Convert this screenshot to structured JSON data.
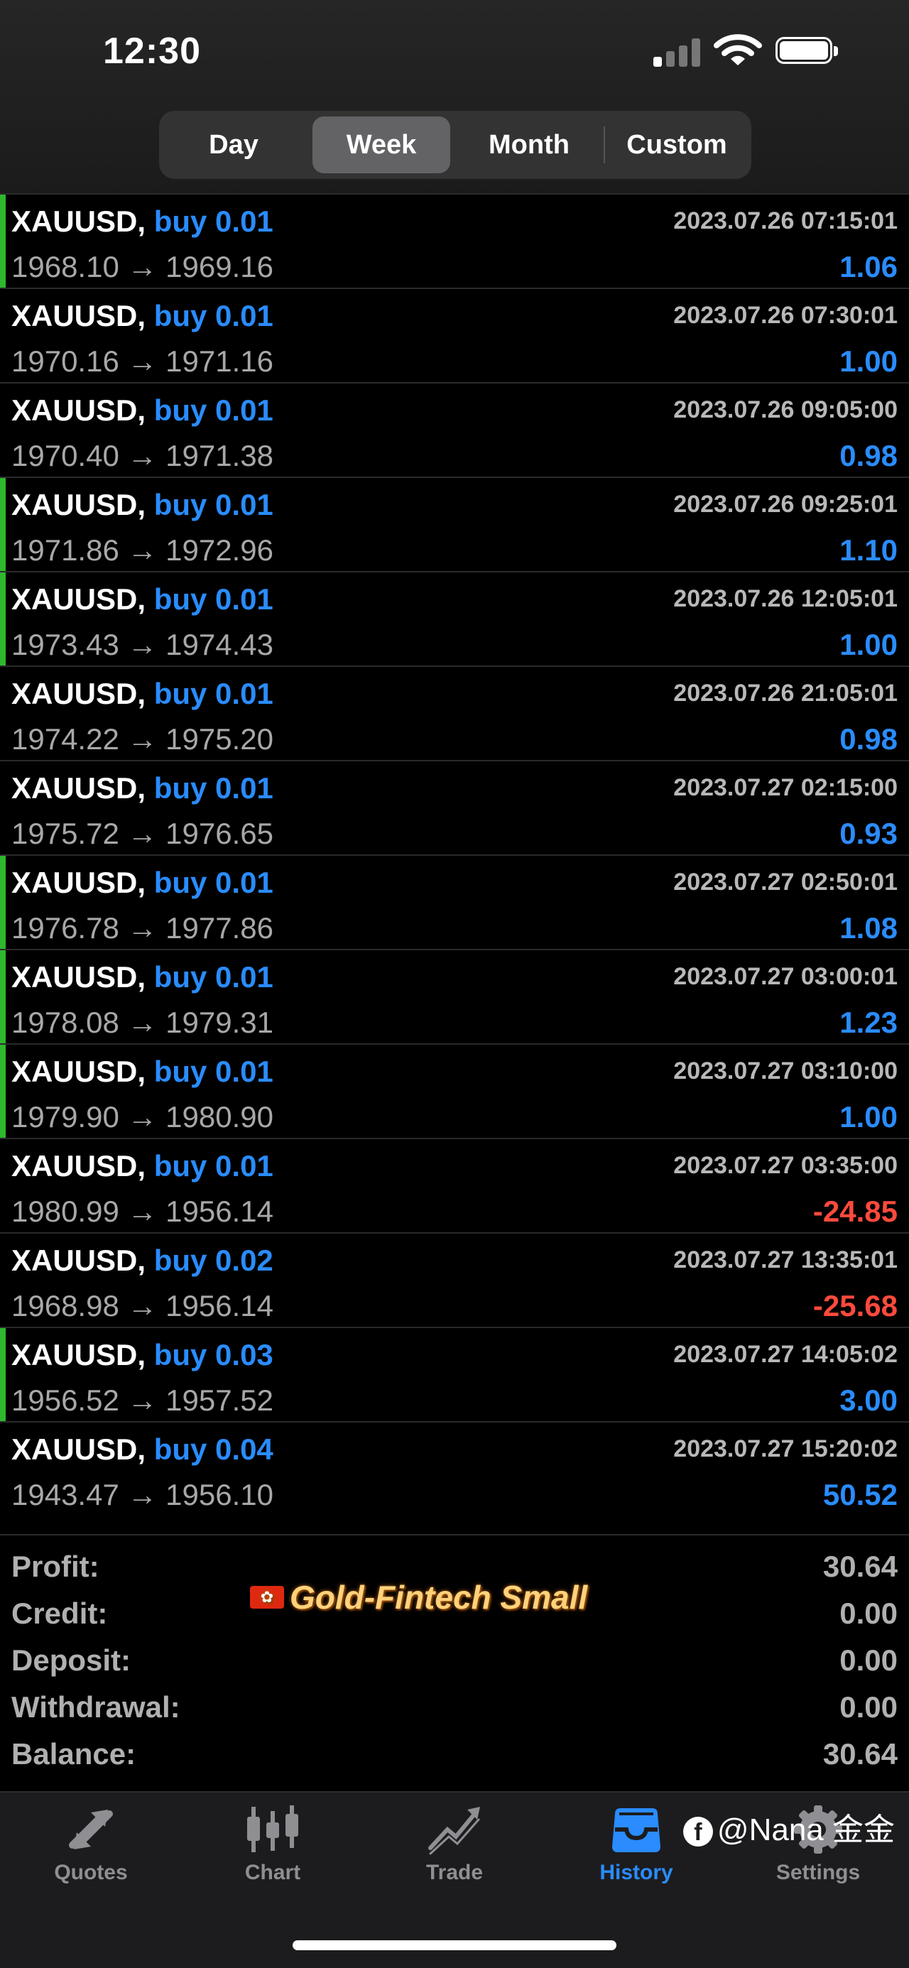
{
  "status_bar": {
    "time": "12:30"
  },
  "period_tabs": [
    {
      "label": "Day",
      "active": false
    },
    {
      "label": "Week",
      "active": true
    },
    {
      "label": "Month",
      "active": false
    },
    {
      "label": "Custom",
      "active": false
    }
  ],
  "trades": [
    {
      "symbol": "XAUUSD,",
      "side": "buy 0.01",
      "time": "2023.07.26 07:15:01",
      "prices": "1968.10 → 1969.16",
      "profit": "1.06",
      "negative": false,
      "marked": true
    },
    {
      "symbol": "XAUUSD,",
      "side": "buy 0.01",
      "time": "2023.07.26 07:30:01",
      "prices": "1970.16 → 1971.16",
      "profit": "1.00",
      "negative": false,
      "marked": false
    },
    {
      "symbol": "XAUUSD,",
      "side": "buy 0.01",
      "time": "2023.07.26 09:05:00",
      "prices": "1970.40 → 1971.38",
      "profit": "0.98",
      "negative": false,
      "marked": false
    },
    {
      "symbol": "XAUUSD,",
      "side": "buy 0.01",
      "time": "2023.07.26 09:25:01",
      "prices": "1971.86 → 1972.96",
      "profit": "1.10",
      "negative": false,
      "marked": true
    },
    {
      "symbol": "XAUUSD,",
      "side": "buy 0.01",
      "time": "2023.07.26 12:05:01",
      "prices": "1973.43 → 1974.43",
      "profit": "1.00",
      "negative": false,
      "marked": true
    },
    {
      "symbol": "XAUUSD,",
      "side": "buy 0.01",
      "time": "2023.07.26 21:05:01",
      "prices": "1974.22 → 1975.20",
      "profit": "0.98",
      "negative": false,
      "marked": false
    },
    {
      "symbol": "XAUUSD,",
      "side": "buy 0.01",
      "time": "2023.07.27 02:15:00",
      "prices": "1975.72 → 1976.65",
      "profit": "0.93",
      "negative": false,
      "marked": false
    },
    {
      "symbol": "XAUUSD,",
      "side": "buy 0.01",
      "time": "2023.07.27 02:50:01",
      "prices": "1976.78 → 1977.86",
      "profit": "1.08",
      "negative": false,
      "marked": true
    },
    {
      "symbol": "XAUUSD,",
      "side": "buy 0.01",
      "time": "2023.07.27 03:00:01",
      "prices": "1978.08 → 1979.31",
      "profit": "1.23",
      "negative": false,
      "marked": true
    },
    {
      "symbol": "XAUUSD,",
      "side": "buy 0.01",
      "time": "2023.07.27 03:10:00",
      "prices": "1979.90 → 1980.90",
      "profit": "1.00",
      "negative": false,
      "marked": true
    },
    {
      "symbol": "XAUUSD,",
      "side": "buy 0.01",
      "time": "2023.07.27 03:35:00",
      "prices": "1980.99 → 1956.14",
      "profit": "-24.85",
      "negative": true,
      "marked": false
    },
    {
      "symbol": "XAUUSD,",
      "side": "buy 0.02",
      "time": "2023.07.27 13:35:01",
      "prices": "1968.98 → 1956.14",
      "profit": "-25.68",
      "negative": true,
      "marked": false
    },
    {
      "symbol": "XAUUSD,",
      "side": "buy 0.03",
      "time": "2023.07.27 14:05:02",
      "prices": "1956.52 → 1957.52",
      "profit": "3.00",
      "negative": false,
      "marked": true
    },
    {
      "symbol": "XAUUSD,",
      "side": "buy 0.04",
      "time": "2023.07.27 15:20:02",
      "prices": "1943.47 → 1956.10",
      "profit": "50.52",
      "negative": false,
      "marked": false
    }
  ],
  "summary": [
    {
      "label": "Profit:",
      "value": "30.64"
    },
    {
      "label": "Credit:",
      "value": "0.00"
    },
    {
      "label": "Deposit:",
      "value": "0.00"
    },
    {
      "label": "Withdrawal:",
      "value": "0.00"
    },
    {
      "label": "Balance:",
      "value": "30.64"
    }
  ],
  "watermark": "Gold-Fintech Small",
  "credit": "@Nana 金金",
  "tabbar": [
    {
      "label": "Quotes",
      "icon": "quotes-icon",
      "active": false
    },
    {
      "label": "Chart",
      "icon": "chart-icon",
      "active": false
    },
    {
      "label": "Trade",
      "icon": "trade-icon",
      "active": false
    },
    {
      "label": "History",
      "icon": "history-icon",
      "active": true
    },
    {
      "label": "Settings",
      "icon": "gear-icon",
      "active": false
    }
  ],
  "colors": {
    "profit": "#2a8cff",
    "loss": "#ff4a3d",
    "marker": "#2eb82e",
    "active_tab": "#2a8cff"
  }
}
